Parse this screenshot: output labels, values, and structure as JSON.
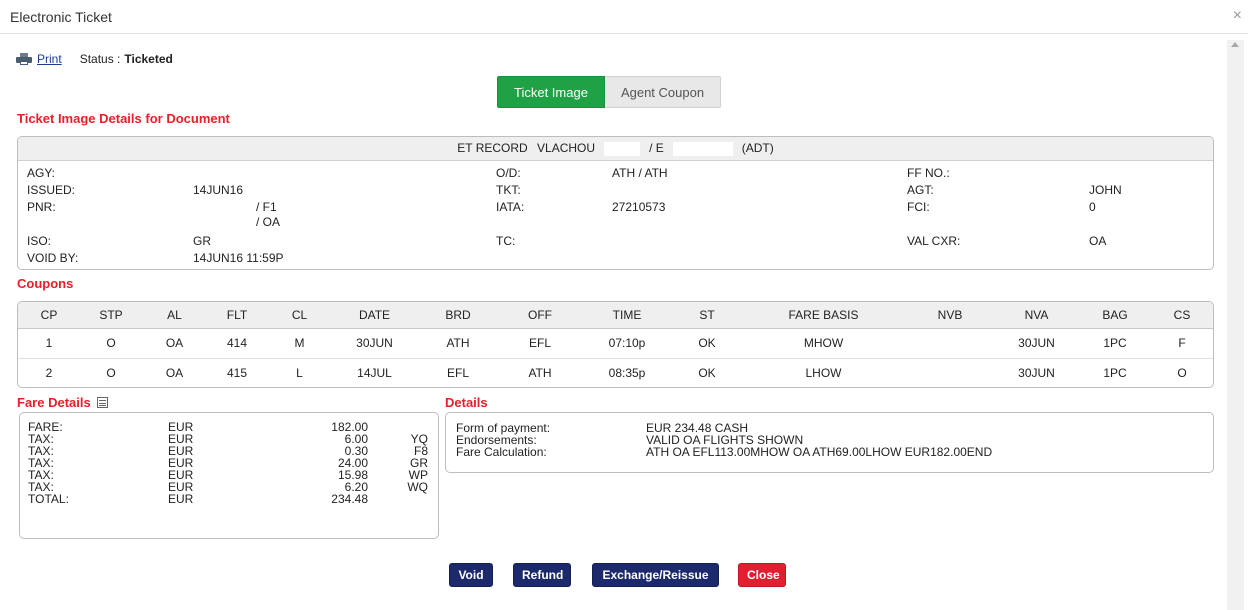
{
  "window": {
    "title": "Electronic Ticket",
    "close_glyph": "×"
  },
  "topbar": {
    "print_label": "Print",
    "status_label": "Status :",
    "status_value": "Ticketed"
  },
  "tabs": [
    {
      "label": "Ticket Image",
      "active": true
    },
    {
      "label": "Agent Coupon",
      "active": false
    }
  ],
  "ticket": {
    "section_title": "Ticket Image Details for Document",
    "header": {
      "record_label": "ET RECORD",
      "name": "VLACHOU",
      "slash": "/ E",
      "pax_type": "(ADT)"
    },
    "fields": {
      "agy_label": "AGY:",
      "agy_value": "",
      "issued_label": "ISSUED:",
      "issued_value": "14JUN16",
      "pnr_label": "PNR:",
      "pnr_value_1": "/ F1",
      "pnr_value_2": "/ OA",
      "iso_label": "ISO:",
      "iso_value": "GR",
      "voidby_label": "VOID BY:",
      "voidby_value": "14JUN16 11:59P",
      "od_label": "O/D:",
      "od_value": "ATH / ATH",
      "tkt_label": "TKT:",
      "tkt_value": "",
      "iata_label": "IATA:",
      "iata_value": "27210573",
      "tc_label": "TC:",
      "tc_value": "",
      "ffno_label": "FF NO.:",
      "ffno_value": "",
      "agt_label": "AGT:",
      "agt_value": "JOHN",
      "fci_label": "FCI:",
      "fci_value": "0",
      "valcxr_label": "VAL CXR:",
      "valcxr_value": "OA"
    }
  },
  "coupons": {
    "section_title": "Coupons",
    "columns": [
      "CP",
      "STP",
      "AL",
      "FLT",
      "CL",
      "DATE",
      "BRD",
      "OFF",
      "TIME",
      "ST",
      "FARE BASIS",
      "NVB",
      "NVA",
      "BAG",
      "CS"
    ],
    "rows": [
      [
        "1",
        "O",
        "OA",
        "414",
        "M",
        "30JUN",
        "ATH",
        "EFL",
        "07:10p",
        "OK",
        "MHOW",
        "",
        "30JUN",
        "1PC",
        "F"
      ],
      [
        "2",
        "O",
        "OA",
        "415",
        "L",
        "14JUL",
        "EFL",
        "ATH",
        "08:35p",
        "OK",
        "LHOW",
        "",
        "30JUN",
        "1PC",
        "O"
      ]
    ]
  },
  "fare_details": {
    "section_title": "Fare Details",
    "icon": "calculator-icon",
    "rows": [
      {
        "label": "FARE:",
        "currency": "EUR",
        "amount": "182.00",
        "code": ""
      },
      {
        "label": "TAX:",
        "currency": "EUR",
        "amount": "6.00",
        "code": "YQ"
      },
      {
        "label": "TAX:",
        "currency": "EUR",
        "amount": "0.30",
        "code": "F8"
      },
      {
        "label": "TAX:",
        "currency": "EUR",
        "amount": "24.00",
        "code": "GR"
      },
      {
        "label": "TAX:",
        "currency": "EUR",
        "amount": "15.98",
        "code": "WP"
      },
      {
        "label": "TAX:",
        "currency": "EUR",
        "amount": "6.20",
        "code": "WQ"
      },
      {
        "label": "TOTAL:",
        "currency": "EUR",
        "amount": "234.48",
        "code": ""
      }
    ]
  },
  "details": {
    "section_title": "Details",
    "rows": [
      {
        "label": "Form of payment:",
        "value": "EUR 234.48 CASH"
      },
      {
        "label": "Endorsements:",
        "value": "VALID OA FLIGHTS SHOWN"
      },
      {
        "label": "Fare Calculation:",
        "value": "ATH OA EFL113.00MHOW OA ATH69.00LHOW EUR182.00END"
      }
    ]
  },
  "buttons": {
    "void": "Void",
    "refund": "Refund",
    "exchange": "Exchange/Reissue",
    "close": "Close"
  },
  "colors": {
    "accent_red": "#e8202a",
    "tab_active": "#1fa245",
    "button_navy": "#1c2a6b",
    "button_red": "#e02030"
  }
}
